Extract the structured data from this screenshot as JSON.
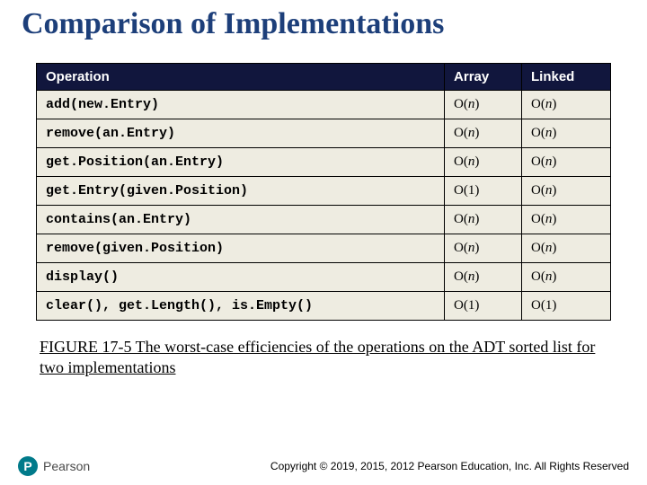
{
  "title": "Comparison of Implementations",
  "table": {
    "headers": {
      "op": "Operation",
      "array": "Array",
      "linked": "Linked"
    },
    "rows": [
      {
        "op": "add(new.Entry)",
        "array": "O(n)",
        "linked": "O(n)"
      },
      {
        "op": "remove(an.Entry)",
        "array": "O(n)",
        "linked": "O(n)"
      },
      {
        "op": "get.Position(an.Entry)",
        "array": "O(n)",
        "linked": "O(n)"
      },
      {
        "op": "get.Entry(given.Position)",
        "array": "O(1)",
        "linked": "O(n)"
      },
      {
        "op": "contains(an.Entry)",
        "array": "O(n)",
        "linked": "O(n)"
      },
      {
        "op": "remove(given.Position)",
        "array": "O(n)",
        "linked": "O(n)"
      },
      {
        "op": "display()",
        "array": "O(n)",
        "linked": "O(n)"
      },
      {
        "op": "clear(), get.Length(), is.Empty()",
        "array": "O(1)",
        "linked": "O(1)"
      }
    ]
  },
  "caption": "FIGURE 17-5 The worst-case efficiencies of the operations on the ADT sorted list for two implementations",
  "footer": {
    "logo_initial": "P",
    "logo_text": "Pearson",
    "copyright": "Copyright © 2019, 2015, 2012 Pearson Education, Inc. All Rights Reserved"
  },
  "chart_data": {
    "type": "table",
    "title": "Comparison of Implementations",
    "columns": [
      "Operation",
      "Array",
      "Linked"
    ],
    "rows": [
      [
        "add(new.Entry)",
        "O(n)",
        "O(n)"
      ],
      [
        "remove(an.Entry)",
        "O(n)",
        "O(n)"
      ],
      [
        "get.Position(an.Entry)",
        "O(n)",
        "O(n)"
      ],
      [
        "get.Entry(given.Position)",
        "O(1)",
        "O(n)"
      ],
      [
        "contains(an.Entry)",
        "O(n)",
        "O(n)"
      ],
      [
        "remove(given.Position)",
        "O(n)",
        "O(n)"
      ],
      [
        "display()",
        "O(n)",
        "O(n)"
      ],
      [
        "clear(), get.Length(), is.Empty()",
        "O(1)",
        "O(1)"
      ]
    ]
  }
}
